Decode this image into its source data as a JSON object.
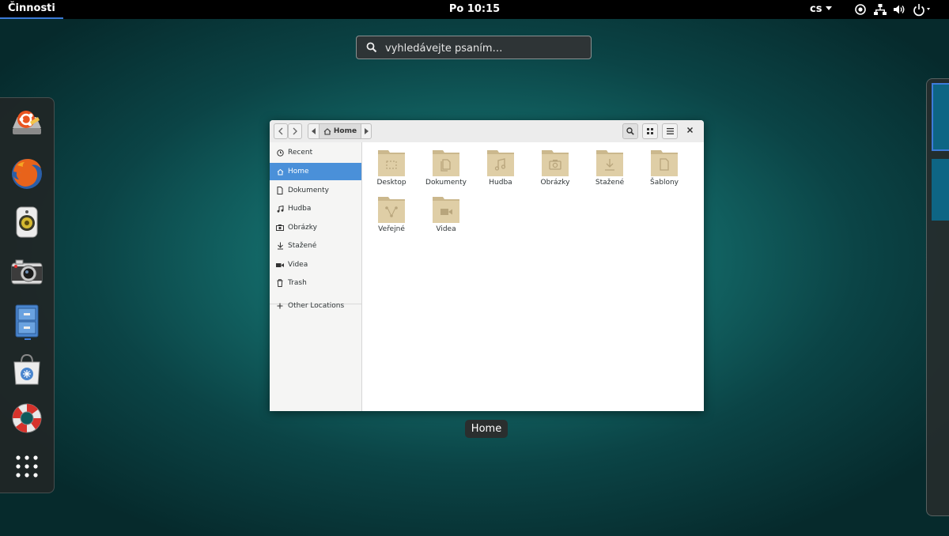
{
  "topbar": {
    "activities": "Činnosti",
    "clock": "Po 10:15",
    "language": "cs",
    "tray_icons": [
      "accessibility-icon",
      "network-icon",
      "volume-icon",
      "power-icon"
    ]
  },
  "search": {
    "placeholder": "vyhledávejte psaním…"
  },
  "dash": {
    "apps": [
      "ubuntu-software-updater-icon",
      "firefox-icon",
      "rhythmbox-speaker-icon",
      "camera-icon",
      "file-cabinet-icon",
      "software-store-icon",
      "help-lifebuoy-icon",
      "show-applications-grid-icon"
    ],
    "running": "file-cabinet-icon"
  },
  "window": {
    "path_home": "Home",
    "sidebar": [
      {
        "label": "Recent",
        "icon": "clock-icon"
      },
      {
        "label": "Home",
        "icon": "home-icon",
        "selected": true
      },
      {
        "label": "Dokumenty",
        "icon": "document-icon"
      },
      {
        "label": "Hudba",
        "icon": "music-icon"
      },
      {
        "label": "Obrázky",
        "icon": "camera-small-icon"
      },
      {
        "label": "Stažené",
        "icon": "download-icon"
      },
      {
        "label": "Videa",
        "icon": "video-icon"
      },
      {
        "label": "Trash",
        "icon": "trash-icon"
      },
      {
        "label": "Other Locations",
        "icon": "plus-icon"
      }
    ],
    "folders": [
      {
        "label": "Desktop",
        "emblem": "desktop"
      },
      {
        "label": "Dokumenty",
        "emblem": "document"
      },
      {
        "label": "Hudba",
        "emblem": "music"
      },
      {
        "label": "Obrázky",
        "emblem": "camera"
      },
      {
        "label": "Stažené",
        "emblem": "download"
      },
      {
        "label": "Šablony",
        "emblem": "template"
      },
      {
        "label": "Veřejné",
        "emblem": "share"
      },
      {
        "label": "Videa",
        "emblem": "video"
      }
    ]
  },
  "tooltip": "Home",
  "colors": {
    "accent": "#3d7bd9",
    "selection": "#4a90d9",
    "folder": "#dcc99f"
  }
}
